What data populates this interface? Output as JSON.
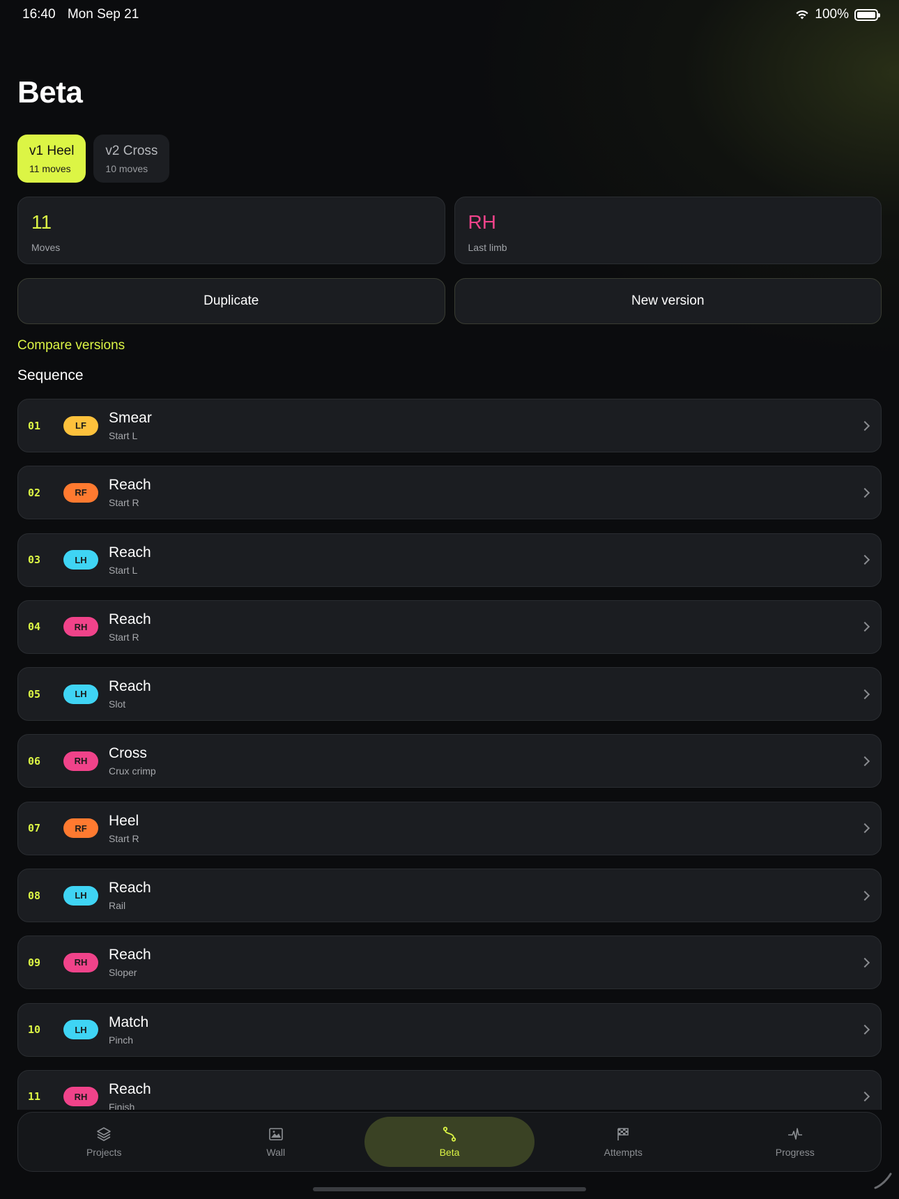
{
  "status_bar": {
    "time": "16:40",
    "date": "Mon Sep 21",
    "battery": "100%"
  },
  "page": {
    "title": "Beta"
  },
  "versions": [
    {
      "name": "v1 Heel",
      "count": "11 moves",
      "active": true
    },
    {
      "name": "v2 Cross",
      "count": "10 moves",
      "active": false
    }
  ],
  "stats": {
    "moves": {
      "value": "11",
      "label": "Moves",
      "color": "#dcf545"
    },
    "last_limb": {
      "value": "RH",
      "label": "Last limb",
      "color": "#f0438a"
    }
  },
  "actions": {
    "duplicate": "Duplicate",
    "new_version": "New version"
  },
  "compare_link": "Compare versions",
  "sequence_title": "Sequence",
  "limb_colors": {
    "LF": "#fdc13c",
    "RF": "#ff7a30",
    "LH": "#3fd4f4",
    "RH": "#f0438a"
  },
  "moves": [
    {
      "num": "01",
      "limb": "LF",
      "name": "Smear",
      "detail": "Start L"
    },
    {
      "num": "02",
      "limb": "RF",
      "name": "Reach",
      "detail": "Start R"
    },
    {
      "num": "03",
      "limb": "LH",
      "name": "Reach",
      "detail": "Start L"
    },
    {
      "num": "04",
      "limb": "RH",
      "name": "Reach",
      "detail": "Start R"
    },
    {
      "num": "05",
      "limb": "LH",
      "name": "Reach",
      "detail": "Slot"
    },
    {
      "num": "06",
      "limb": "RH",
      "name": "Cross",
      "detail": "Crux crimp"
    },
    {
      "num": "07",
      "limb": "RF",
      "name": "Heel",
      "detail": "Start R"
    },
    {
      "num": "08",
      "limb": "LH",
      "name": "Reach",
      "detail": "Rail"
    },
    {
      "num": "09",
      "limb": "RH",
      "name": "Reach",
      "detail": "Sloper"
    },
    {
      "num": "10",
      "limb": "LH",
      "name": "Match",
      "detail": "Pinch"
    },
    {
      "num": "11",
      "limb": "RH",
      "name": "Reach",
      "detail": "Finish"
    }
  ],
  "tabs": {
    "projects": {
      "label": "Projects",
      "icon": "layers-icon"
    },
    "wall": {
      "label": "Wall",
      "icon": "image-icon"
    },
    "beta": {
      "label": "Beta",
      "icon": "route-icon"
    },
    "attempts": {
      "label": "Attempts",
      "icon": "flag-icon"
    },
    "progress": {
      "label": "Progress",
      "icon": "pulse-icon"
    }
  }
}
